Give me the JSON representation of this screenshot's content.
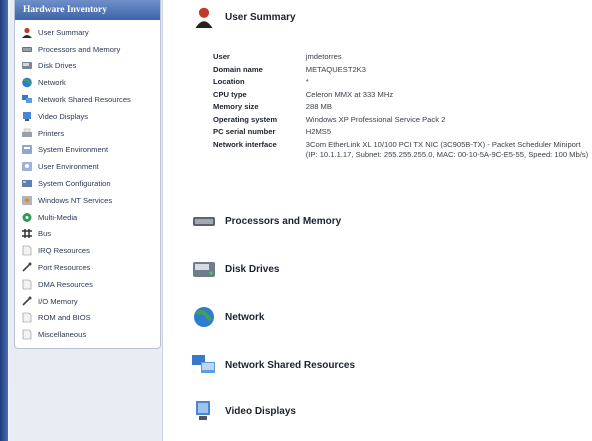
{
  "sidebar": {
    "header": "Hardware Inventory",
    "items": [
      {
        "label": "User Summary",
        "icon": "user-icon"
      },
      {
        "label": "Processors and Memory",
        "icon": "chip-icon"
      },
      {
        "label": "Disk Drives",
        "icon": "disk-icon"
      },
      {
        "label": "Network",
        "icon": "globe-icon"
      },
      {
        "label": "Network Shared Resources",
        "icon": "shared-resources-icon"
      },
      {
        "label": "Video Displays",
        "icon": "monitor-icon"
      },
      {
        "label": "Printers",
        "icon": "printer-icon"
      },
      {
        "label": "System Environment",
        "icon": "system-env-icon"
      },
      {
        "label": "User Environment",
        "icon": "user-env-icon"
      },
      {
        "label": "System Configuration",
        "icon": "config-icon"
      },
      {
        "label": "Windows NT Services",
        "icon": "services-icon"
      },
      {
        "label": "Multi-Media",
        "icon": "multimedia-icon"
      },
      {
        "label": "Bus",
        "icon": "bus-icon"
      },
      {
        "label": "IRQ Resources",
        "icon": "irq-icon"
      },
      {
        "label": "Port Resources",
        "icon": "port-icon"
      },
      {
        "label": "DMA Resources",
        "icon": "dma-icon"
      },
      {
        "label": "I/O Memory",
        "icon": "io-memory-icon"
      },
      {
        "label": "ROM and BIOS",
        "icon": "rom-icon"
      },
      {
        "label": "Miscellaneous",
        "icon": "misc-icon"
      }
    ]
  },
  "main": {
    "user_summary": {
      "title": "User Summary",
      "rows": [
        {
          "key": "User",
          "value": "jmdetorres"
        },
        {
          "key": "Domain name",
          "value": "METAQUEST2K3"
        },
        {
          "key": "Location",
          "value": "*"
        },
        {
          "key": "CPU type",
          "value": "Celeron MMX at 333 MHz"
        },
        {
          "key": "Memory size",
          "value": "288 MB"
        },
        {
          "key": "Operating system",
          "value": "Windows XP Professional Service Pack 2"
        },
        {
          "key": "PC serial number",
          "value": "H2MS5"
        },
        {
          "key": "Network interface",
          "value": "3Com EtherLink XL 10/100 PCI TX NIC (3C905B-TX) - Packet Scheduler Miniport (IP: 10.1.1.17, Subnet: 255.255.255.0, MAC: 00-10-5A-9C-E5-55, Speed: 100 Mb/s)"
        }
      ]
    },
    "sections": [
      {
        "title": "Processors and Memory"
      },
      {
        "title": "Disk Drives"
      },
      {
        "title": "Network"
      },
      {
        "title": "Network Shared Resources"
      },
      {
        "title": "Video Displays"
      }
    ]
  },
  "colors": {
    "header_blue": "#3e63a8",
    "strip_blue": "#1f3a7a",
    "sidebar_bg": "#e9ecf2"
  }
}
